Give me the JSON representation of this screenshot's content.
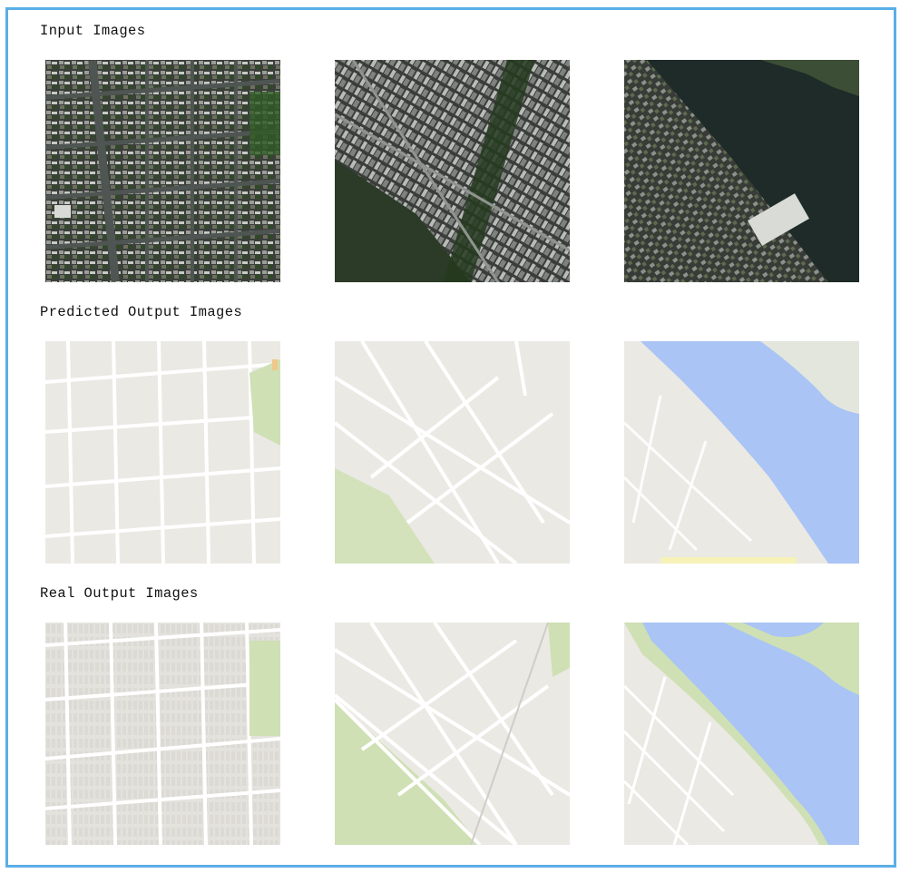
{
  "sections": {
    "input": {
      "title": "Input Images"
    },
    "predicted": {
      "title": "Predicted Output Images"
    },
    "real": {
      "title": "Real Output Images"
    }
  },
  "palette": {
    "frame": "#5aaee6",
    "satellite_dark": "#2f3330",
    "satellite_water": "#1e2b28",
    "map_land": "#ebe9e4",
    "map_road": "#ffffff",
    "map_park": "#cfe0b4",
    "map_water": "#a9c4f5"
  }
}
